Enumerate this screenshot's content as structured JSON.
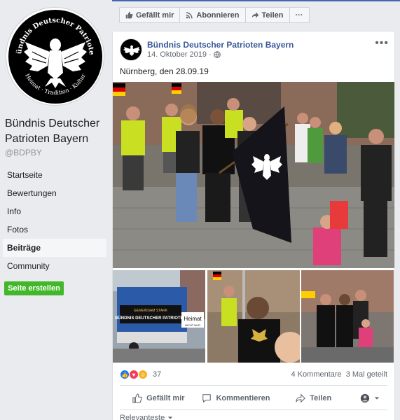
{
  "sidebar": {
    "page_name": "Bündnis Deutscher Patrioten Bayern",
    "handle": "@BDPBY",
    "nav": [
      {
        "label": "Startseite",
        "active": false
      },
      {
        "label": "Bewertungen",
        "active": false
      },
      {
        "label": "Info",
        "active": false
      },
      {
        "label": "Fotos",
        "active": false
      },
      {
        "label": "Beiträge",
        "active": true
      },
      {
        "label": "Community",
        "active": false
      }
    ],
    "create_page_label": "Seite erstellen",
    "logo_text_top": "Bündnis Deutscher Patrioten",
    "logo_text_bottom": "Heimat · Tradition · Kultur"
  },
  "action_bar": {
    "like_label": "Gefällt mir",
    "follow_label": "Abonnieren",
    "share_label": "Teilen",
    "more_label": "···"
  },
  "post": {
    "author": "Bündnis Deutscher Patrioten Bayern",
    "date": "14. Oktober 2019",
    "separator": "·",
    "text": "Nürnberg, den 28.09.19",
    "reaction_count": "37",
    "comments": "4 Kommentare",
    "shares": "3 Mal geteilt",
    "actions": {
      "like": "Gefällt mir",
      "comment": "Kommentieren",
      "share": "Teilen"
    },
    "sort_label": "Relevanteste",
    "photo_banner_text": "BÜNDNIS DEUTSCHER PATRIOTEN",
    "photo_banner_small": "GEMEINSAM STARK",
    "photo_sign": "Heimat",
    "photo_sign_sub": "NICHT NUR"
  },
  "colors": {
    "fb_blue": "#4267b2",
    "link": "#385898",
    "green": "#42b72a",
    "bg": "#e9ebee"
  }
}
